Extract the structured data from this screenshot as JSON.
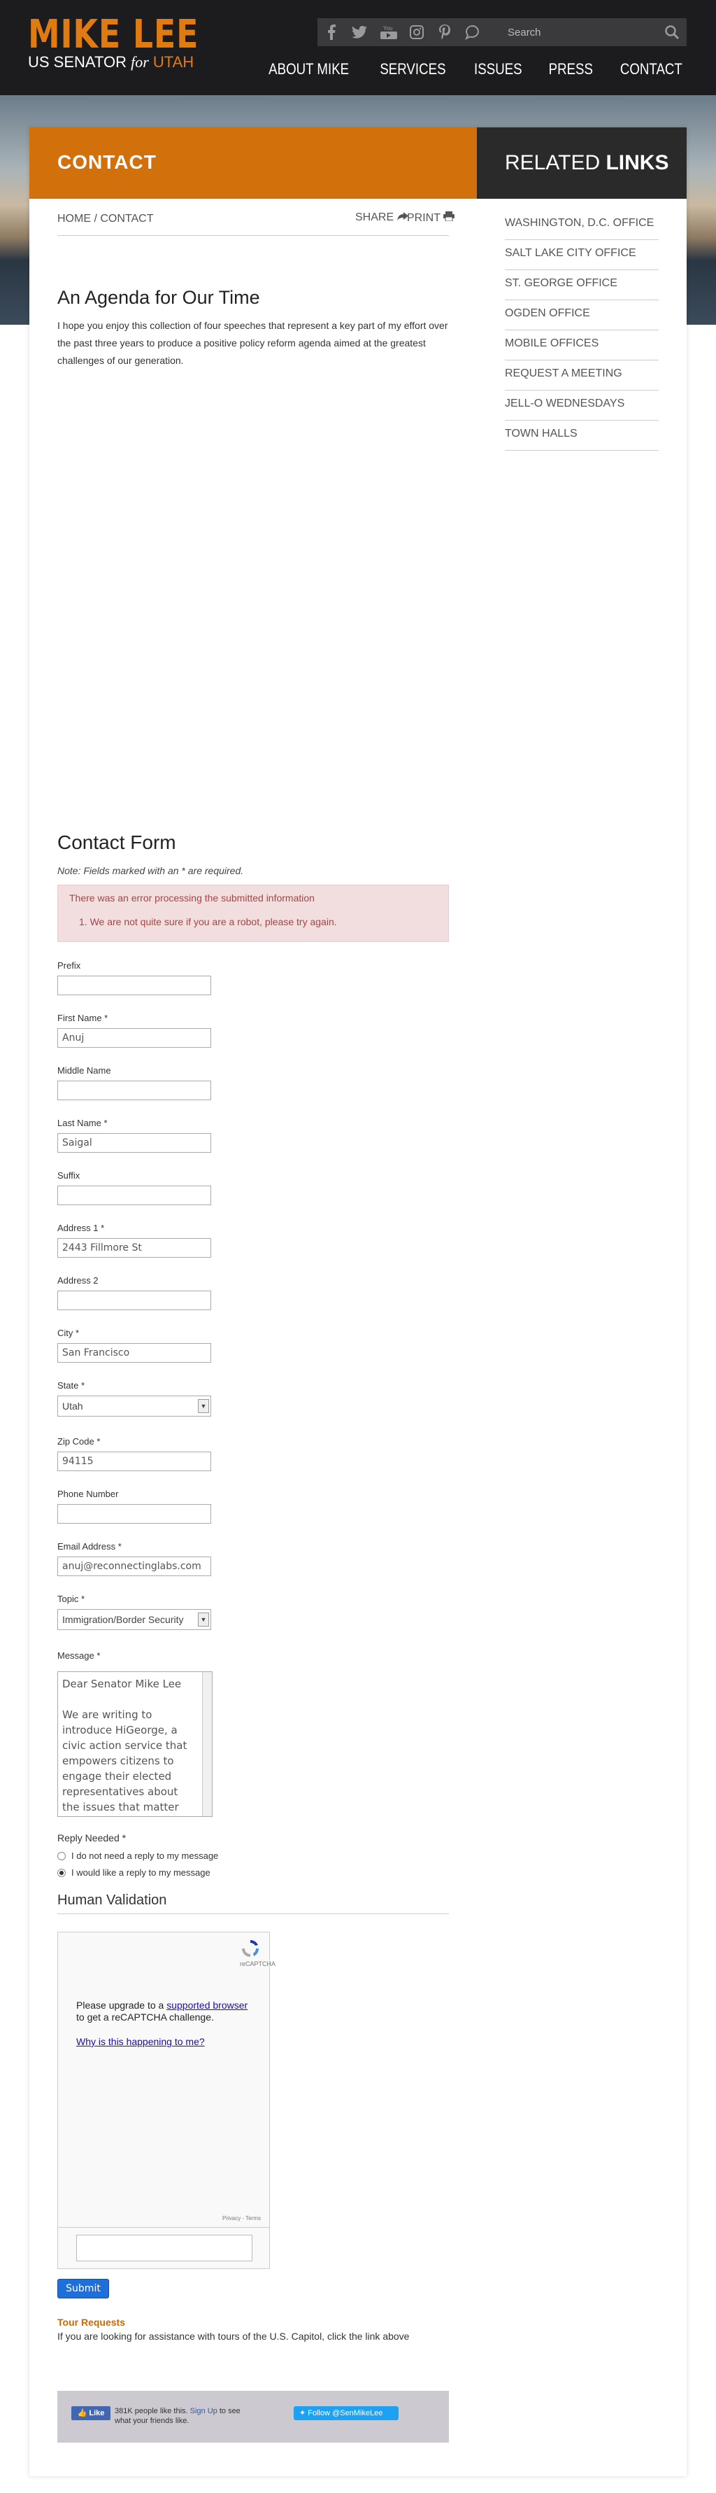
{
  "header": {
    "logo_name": "MIKE LEE",
    "logo_prefix": "US SENATOR ",
    "logo_for": "for",
    "logo_state": " UTAH",
    "search_placeholder": "Search",
    "social": [
      "facebook-icon",
      "twitter-icon",
      "youtube-icon",
      "instagram-icon",
      "pinterest-icon",
      "chat-icon"
    ],
    "youtube_label": "You",
    "nav": [
      "ABOUT MIKE",
      "SERVICES",
      "ISSUES",
      "PRESS",
      "CONTACT"
    ]
  },
  "banner": {
    "contact": "CONTACT",
    "related_prefix": "RELATED ",
    "related_bold": "LINKS"
  },
  "breadcrumb": "HOME / CONTACT",
  "share_label": "SHARE",
  "print_label": "PRINT",
  "related_links": [
    "WASHINGTON, D.C. OFFICE",
    "SALT LAKE CITY OFFICE",
    "ST. GEORGE OFFICE",
    "OGDEN OFFICE",
    "MOBILE OFFICES",
    "REQUEST A MEETING",
    "JELL-O WEDNESDAYS",
    "TOWN HALLS"
  ],
  "agenda": {
    "title": "An Agenda for Our Time",
    "text": "I hope you enjoy this collection of four speeches that represent a key part of my effort over the past three years to produce a positive policy reform agenda aimed at the greatest challenges of our generation."
  },
  "form": {
    "title": "Contact Form",
    "note": "Note: Fields marked with an * are required.",
    "error_message": "There was an error processing the submitted information",
    "error_item": "1.   We are not quite sure if you are a robot, please try again.",
    "fields": {
      "prefix": {
        "label": "Prefix",
        "value": ""
      },
      "first_name": {
        "label": "First Name *",
        "value": "Anuj"
      },
      "middle_name": {
        "label": "Middle Name",
        "value": ""
      },
      "last_name": {
        "label": "Last Name *",
        "value": "Saigal"
      },
      "suffix": {
        "label": "Suffix",
        "value": ""
      },
      "address1": {
        "label": "Address 1 *",
        "value": "2443 Fillmore St"
      },
      "address2": {
        "label": "Address 2",
        "value": ""
      },
      "city": {
        "label": "City *",
        "value": "San Francisco"
      },
      "state": {
        "label": "State *",
        "value": "Utah"
      },
      "zip": {
        "label": "Zip Code *",
        "value": "94115"
      },
      "phone": {
        "label": "Phone Number",
        "value": ""
      },
      "email": {
        "label": "Email Address *",
        "value": "anuj@reconnectinglabs.com"
      },
      "topic": {
        "label": "Topic *",
        "value": "Immigration/Border Security"
      },
      "message": {
        "label": "Message *",
        "value": "Dear Senator Mike Lee\n\nWe are writing to introduce HiGeorge, a civic action service that empowers citizens to engage their elected representatives about the issues that matter most. HiGeorge is accessed through citizens'"
      }
    },
    "reply": {
      "label": "Reply Needed *",
      "option_no": "I do not need a reply to my message",
      "option_yes": "I would like a reply to my message"
    },
    "human_validation": "Human Validation",
    "captcha": {
      "text_pre": "Please upgrade to a ",
      "text_link": "supported browser",
      "text_post": " to get a reCAPTCHA challenge.",
      "why": "Why is this happening to me?",
      "brand": "reCAPTCHA",
      "footer": "Privacy - Terms"
    },
    "submit": "Submit"
  },
  "tour": {
    "title": "Tour Requests",
    "text": "If you are looking for assistance with tours of the U.S. Capitol, click the link above"
  },
  "social_widgets": {
    "fb_like": "Like",
    "fb_text_pre": "381K people like this. ",
    "fb_signup": "Sign Up",
    "fb_text_post": " to see what your friends like.",
    "twitter_follow": "Follow @SenMikeLee"
  }
}
